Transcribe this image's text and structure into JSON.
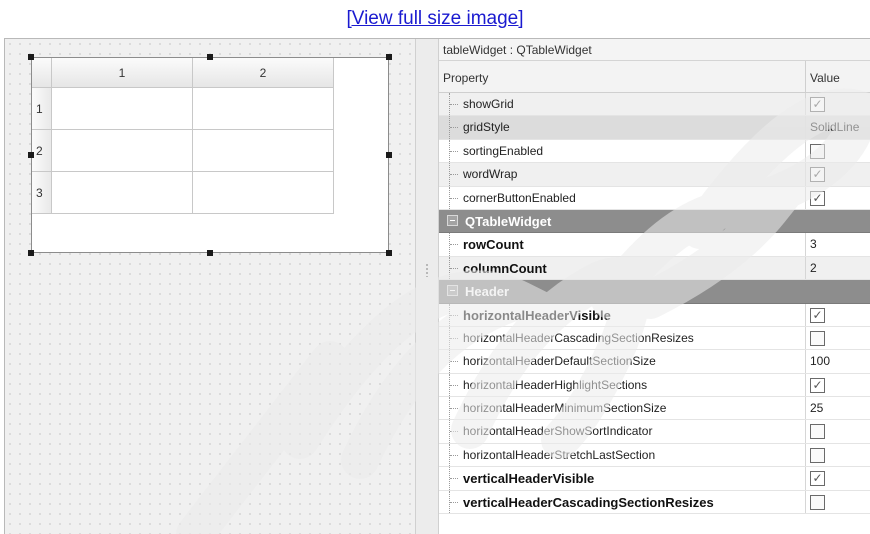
{
  "page": {
    "link_text": "[View full size image]"
  },
  "designer": {
    "columns": [
      "1",
      "2"
    ],
    "rows": [
      "1",
      "2",
      "3"
    ]
  },
  "property_editor": {
    "object_label": "tableWidget : QTableWidget",
    "header": {
      "property": "Property",
      "value": "Value"
    },
    "rows": [
      {
        "kind": "prop",
        "name": "showGrid",
        "type": "check",
        "checked": true,
        "shade": true
      },
      {
        "kind": "prop",
        "name": "gridStyle",
        "type": "text",
        "value": "SolidLine",
        "dark": true
      },
      {
        "kind": "prop",
        "name": "sortingEnabled",
        "type": "check",
        "checked": false
      },
      {
        "kind": "prop",
        "name": "wordWrap",
        "type": "check",
        "checked": true,
        "shade": true
      },
      {
        "kind": "prop",
        "name": "cornerButtonEnabled",
        "type": "check",
        "checked": true
      },
      {
        "kind": "group",
        "name": "QTableWidget"
      },
      {
        "kind": "prop",
        "name": "rowCount",
        "type": "text",
        "value": "3",
        "bold": true
      },
      {
        "kind": "prop",
        "name": "columnCount",
        "type": "text",
        "value": "2",
        "bold": true,
        "shade": true
      },
      {
        "kind": "group",
        "name": "Header"
      },
      {
        "kind": "prop",
        "name": "horizontalHeaderVisible",
        "type": "check",
        "checked": true,
        "bold": true
      },
      {
        "kind": "prop",
        "name": "horizontalHeaderCascadingSectionResizes",
        "type": "check",
        "checked": false
      },
      {
        "kind": "prop",
        "name": "horizontalHeaderDefaultSectionSize",
        "type": "text",
        "value": "100"
      },
      {
        "kind": "prop",
        "name": "horizontalHeaderHighlightSections",
        "type": "check",
        "checked": true
      },
      {
        "kind": "prop",
        "name": "horizontalHeaderMinimumSectionSize",
        "type": "text",
        "value": "25"
      },
      {
        "kind": "prop",
        "name": "horizontalHeaderShowSortIndicator",
        "type": "check",
        "checked": false
      },
      {
        "kind": "prop",
        "name": "horizontalHeaderStretchLastSection",
        "type": "check",
        "checked": false
      },
      {
        "kind": "prop",
        "name": "verticalHeaderVisible",
        "type": "check",
        "checked": true,
        "bold": true
      },
      {
        "kind": "prop",
        "name": "verticalHeaderCascadingSectionResizes",
        "type": "check",
        "checked": false,
        "bold": true
      }
    ]
  }
}
